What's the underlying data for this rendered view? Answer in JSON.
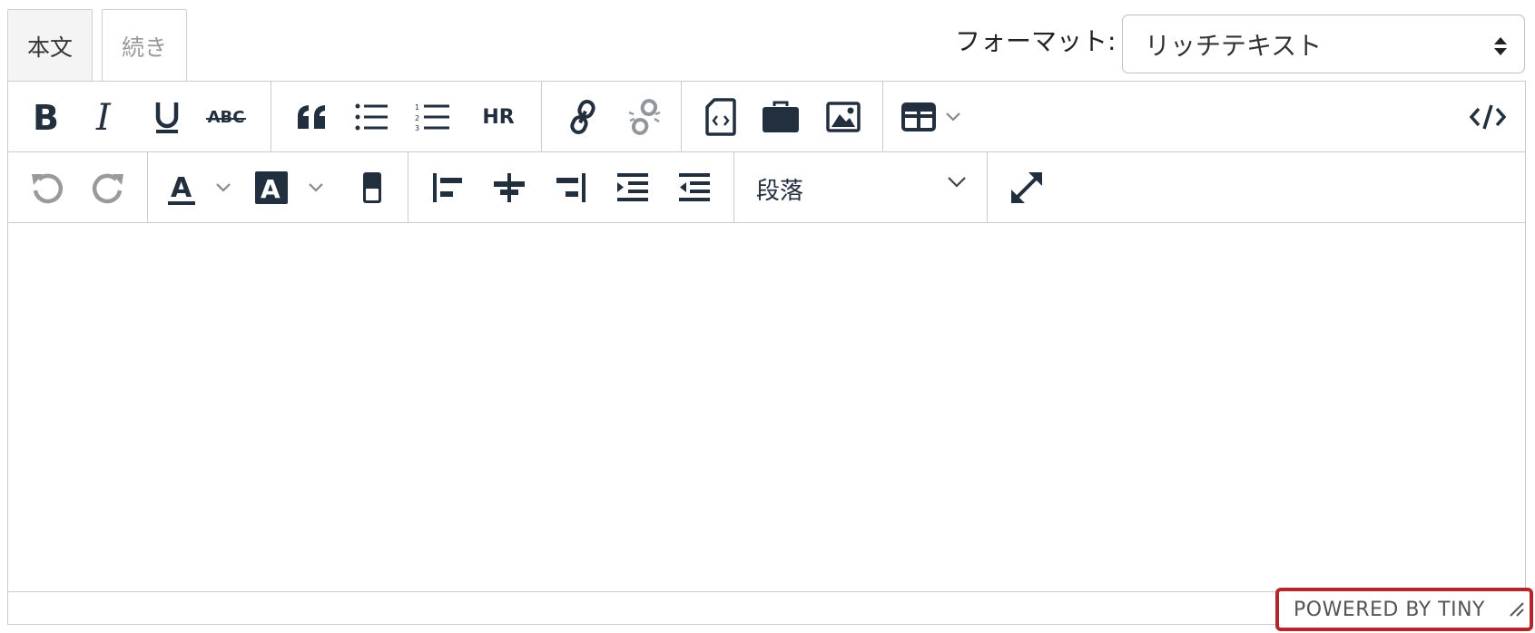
{
  "tabs": {
    "body": "本文",
    "more": "続き"
  },
  "format": {
    "label": "フォーマット:",
    "value": "リッチテキスト"
  },
  "toolbar": {
    "strikethrough_text": "ABC",
    "hr_text": "HR",
    "paragraph_format": "段落"
  },
  "icons": {
    "bold": "bold-icon",
    "italic": "italic-icon",
    "underline": "underline-icon",
    "strikethrough": "strikethrough-icon",
    "blockquote": "blockquote-icon",
    "bullet_list": "bullet-list-icon",
    "numbered_list": "numbered-list-icon",
    "horizontal_rule": "horizontal-rule-icon",
    "link": "link-icon",
    "unlink": "unlink-icon",
    "embed_file": "embed-file-icon",
    "briefcase": "briefcase-icon",
    "image": "image-icon",
    "table": "table-icon",
    "source_code": "source-code-icon",
    "undo": "undo-icon",
    "redo": "redo-icon",
    "text_color": "text-color-icon",
    "background_color": "background-color-icon",
    "highlight": "highlight-icon",
    "align_left": "align-left-icon",
    "align_center": "align-center-icon",
    "align_right": "align-right-icon",
    "indent": "indent-icon",
    "outdent": "outdent-icon",
    "fullscreen": "fullscreen-icon"
  },
  "statusbar": {
    "branding": "POWERED BY TINY"
  },
  "colors": {
    "icon": "#222f3e",
    "disabled": "#9a9a9a",
    "border": "#cccccc",
    "highlight_border": "#b3262c"
  }
}
